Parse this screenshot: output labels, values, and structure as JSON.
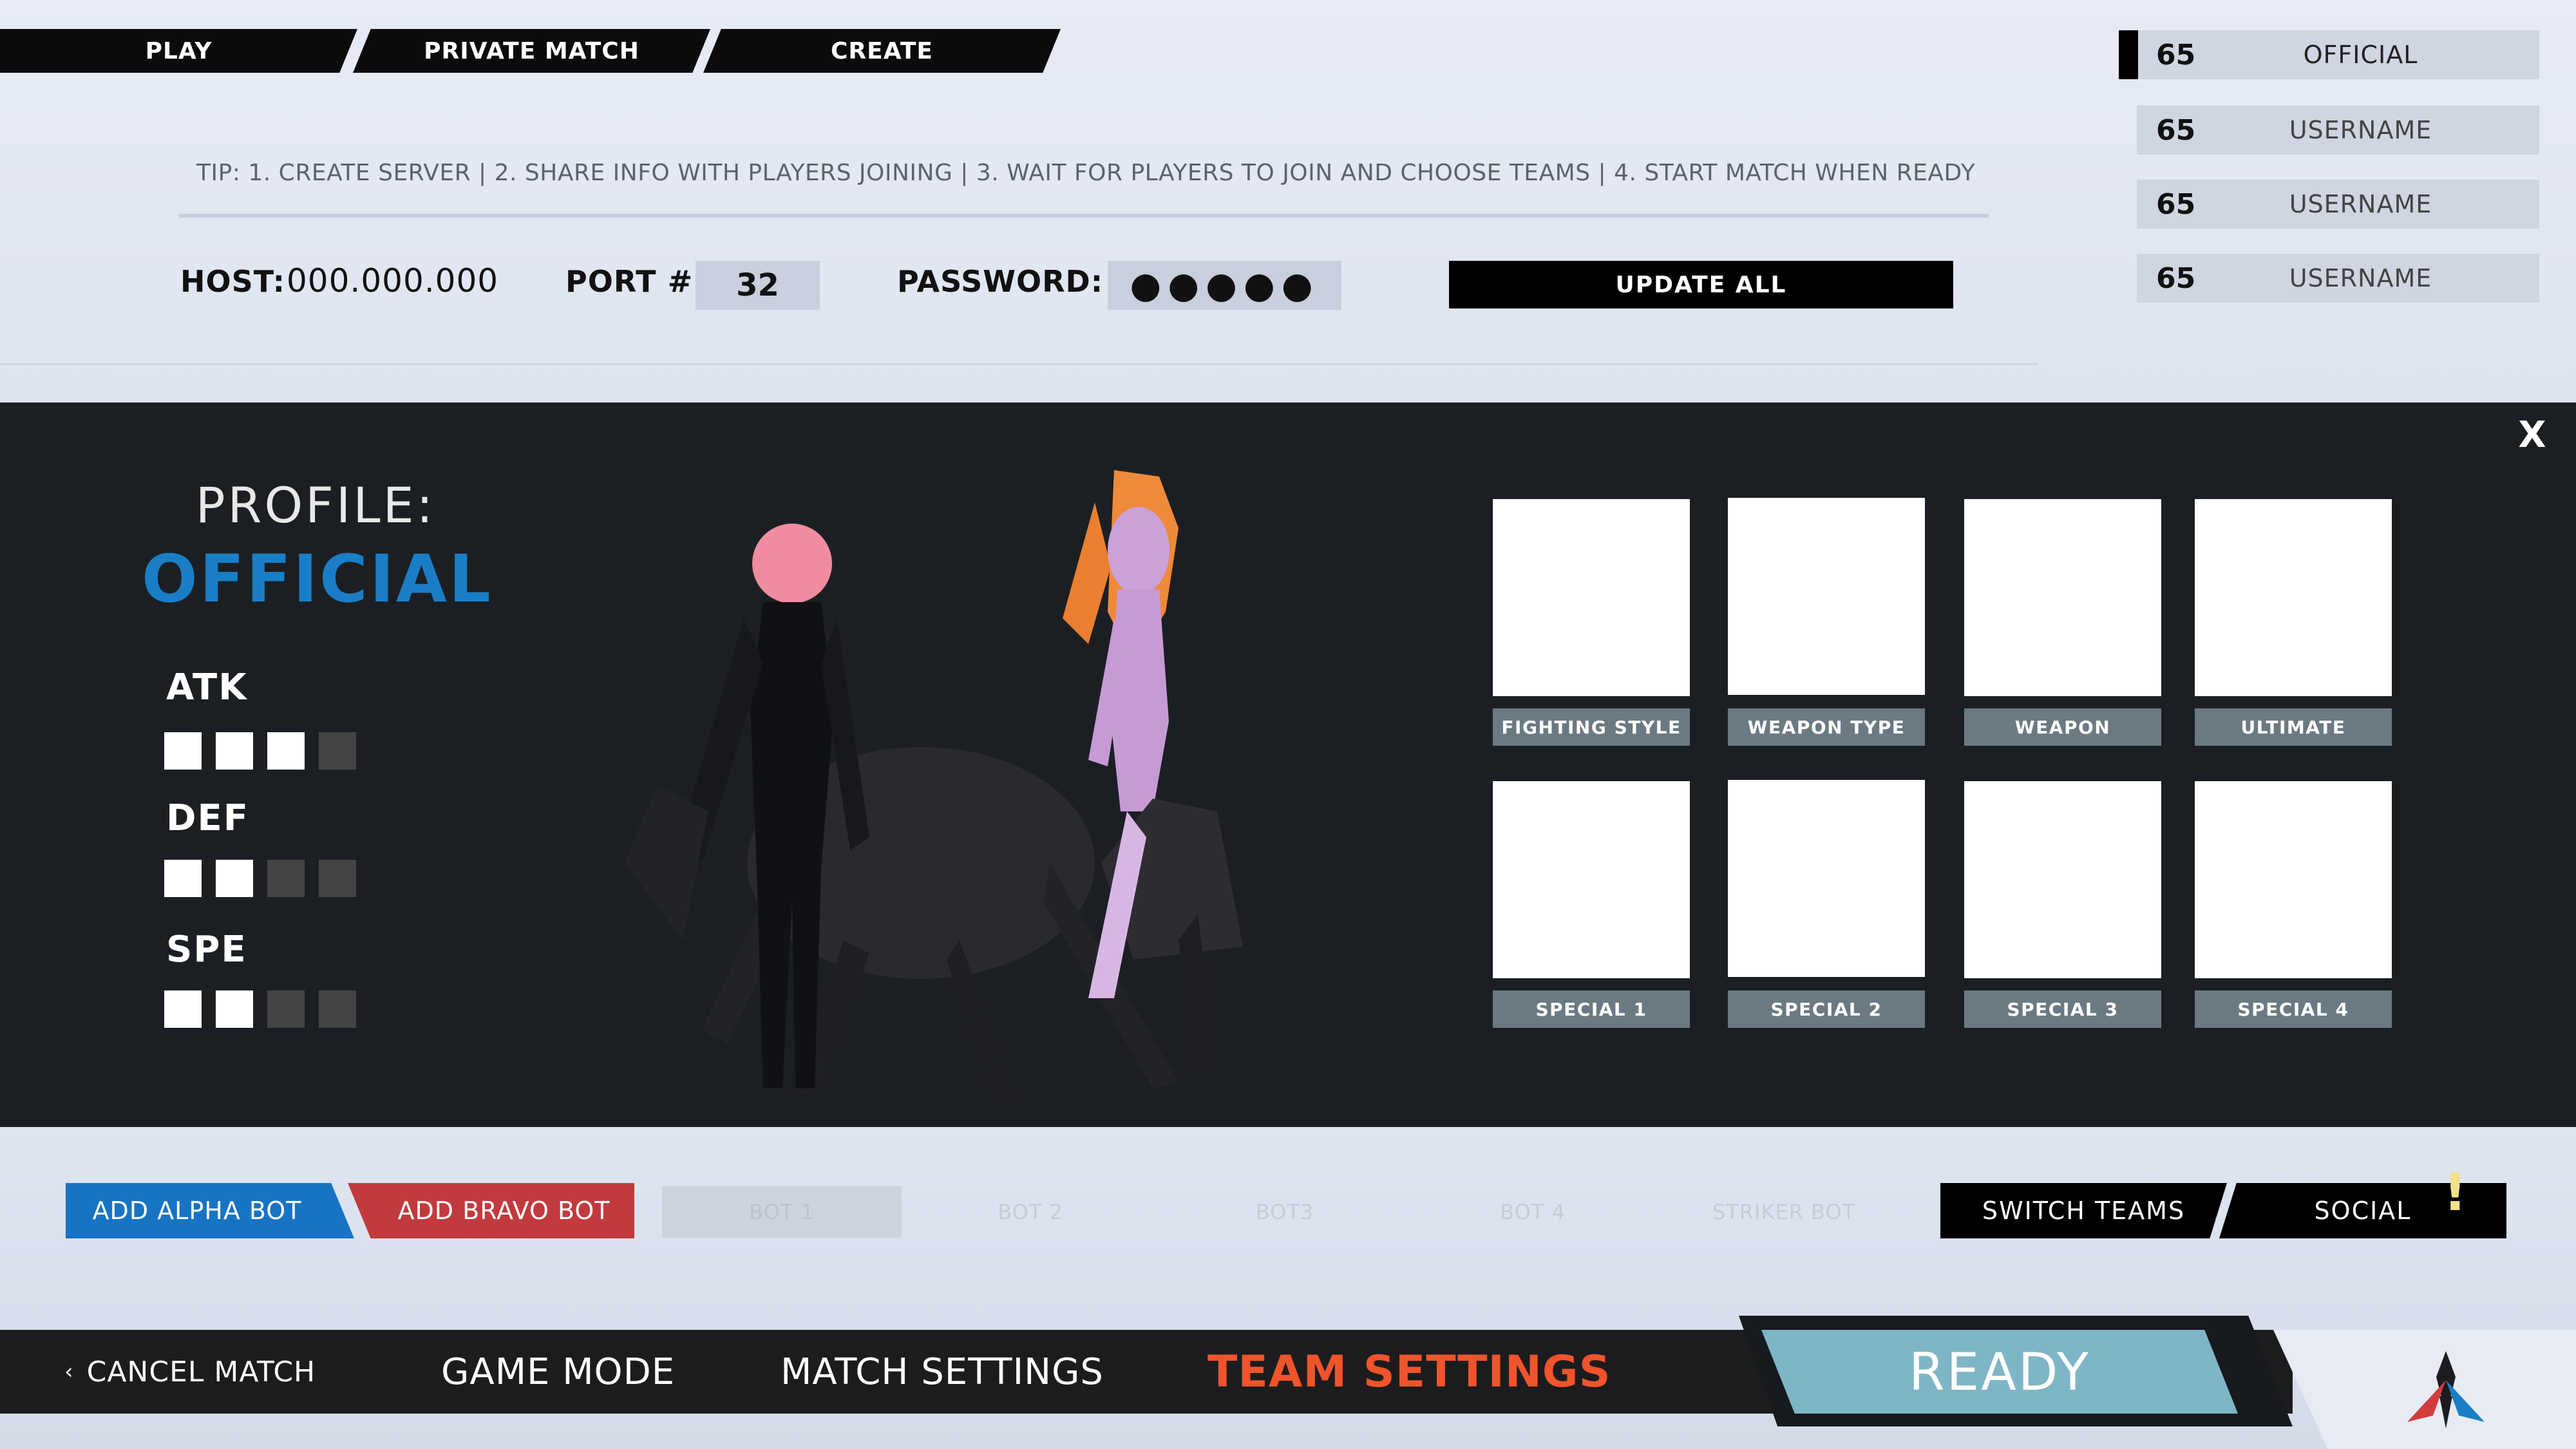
{
  "tabs": {
    "play": "PLAY",
    "private_match": "PRIVATE MATCH",
    "create": "CREATE"
  },
  "tip": "TIP: 1. CREATE SERVER  |  2. SHARE INFO WITH PLAYERS JOINING  |  3. WAIT FOR PLAYERS TO JOIN AND CHOOSE TEAMS |  4. START MATCH WHEN READY",
  "server": {
    "host_label": "HOST:",
    "host_value": "000.000.000",
    "port_label": "PORT #",
    "port_value": "32",
    "password_label": "PASSWORD:",
    "password_value": "●●●●●",
    "update_label": "UPDATE ALL"
  },
  "players": [
    {
      "level": "65",
      "name": "OFFICIAL"
    },
    {
      "level": "65",
      "name": "USERNAME"
    },
    {
      "level": "65",
      "name": "USERNAME"
    },
    {
      "level": "65",
      "name": "USERNAME"
    }
  ],
  "profile": {
    "title": "PROFILE:",
    "name": "OFFICIAL",
    "close": "X",
    "stats": [
      {
        "label": "ATK",
        "value": 3,
        "max": 4
      },
      {
        "label": "DEF",
        "value": 2,
        "max": 4
      },
      {
        "label": "SPE",
        "value": 2,
        "max": 4
      }
    ],
    "loadout": [
      "FIGHTING STYLE",
      "WEAPON TYPE",
      "WEAPON",
      "ULTIMATE",
      "SPECIAL 1",
      "SPECIAL 2",
      "SPECIAL 3",
      "SPECIAL 4"
    ]
  },
  "bots": {
    "add_alpha": "ADD ALPHA BOT",
    "add_bravo": "ADD BRAVO BOT",
    "slots": [
      "BOT 1",
      "BOT 2",
      "BOT3",
      "BOT 4",
      "STRIKER BOT"
    ],
    "switch_teams": "SWITCH TEAMS",
    "social": "SOCIAL",
    "social_alert": "!"
  },
  "nav": {
    "cancel_icon": "‹",
    "cancel": "CANCEL MATCH",
    "game_mode": "GAME MODE",
    "match_settings": "MATCH SETTINGS",
    "team_settings": "TEAM SETTINGS",
    "ready": "READY"
  },
  "colors": {
    "accent_blue": "#1a7ec6",
    "alpha_blue": "#1774c4",
    "bravo_red": "#c23a3d",
    "active_orange": "#f0542c",
    "ready_teal": "#7eb6c7"
  }
}
